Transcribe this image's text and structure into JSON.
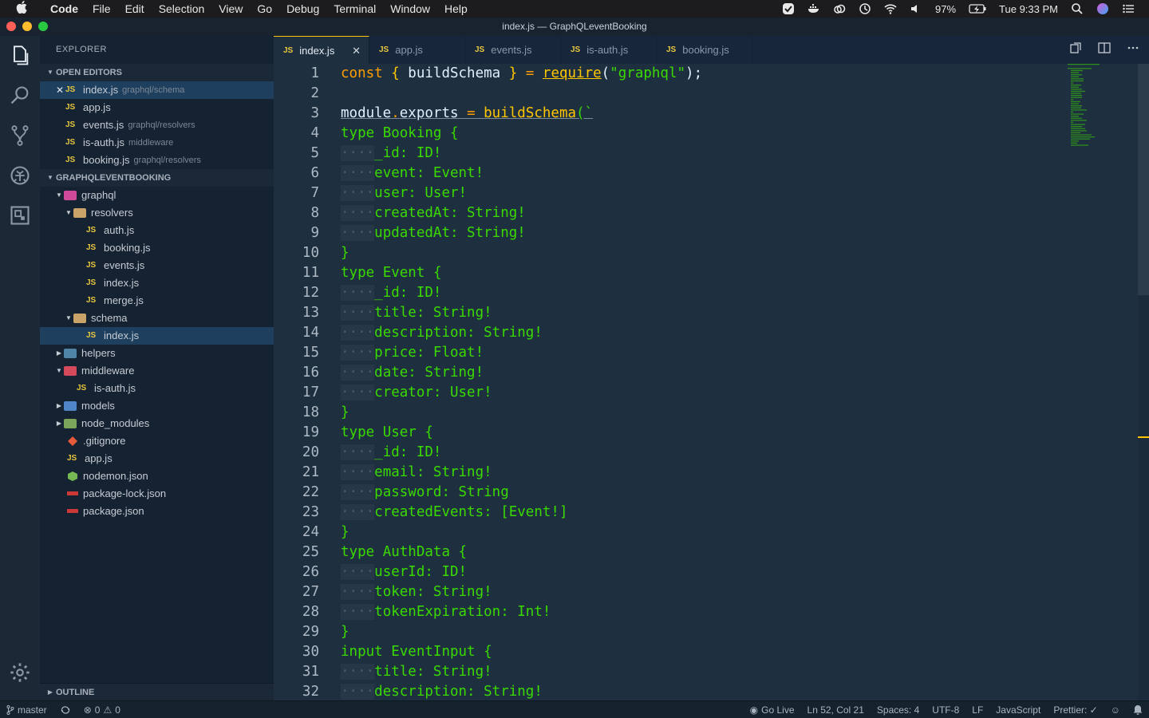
{
  "menubar": {
    "app": "Code",
    "items": [
      "File",
      "Edit",
      "Selection",
      "View",
      "Go",
      "Debug",
      "Terminal",
      "Window",
      "Help"
    ],
    "battery": "97%",
    "clock": "Tue 9:33 PM"
  },
  "window": {
    "title": "index.js — GraphQLeventBooking"
  },
  "sidebar": {
    "title": "EXPLORER",
    "open_editors_label": "OPEN EDITORS",
    "open_editors": [
      {
        "name": "index.js",
        "desc": "graphql/schema"
      },
      {
        "name": "app.js",
        "desc": ""
      },
      {
        "name": "events.js",
        "desc": "graphql/resolvers"
      },
      {
        "name": "is-auth.js",
        "desc": "middleware"
      },
      {
        "name": "booking.js",
        "desc": "graphql/resolvers"
      }
    ],
    "project_label": "GRAPHQLEVENTBOOKING",
    "tree": {
      "graphql": "graphql",
      "resolvers": "resolvers",
      "auth": "auth.js",
      "booking": "booking.js",
      "events": "events.js",
      "resolvers_index": "index.js",
      "merge": "merge.js",
      "schema": "schema",
      "schema_index": "index.js",
      "helpers": "helpers",
      "middleware": "middleware",
      "is_auth": "is-auth.js",
      "models": "models",
      "node_modules": "node_modules",
      "gitignore": ".gitignore",
      "app": "app.js",
      "nodemon": "nodemon.json",
      "package_lock": "package-lock.json",
      "package": "package.json"
    },
    "outline_label": "OUTLINE"
  },
  "tabs": [
    {
      "label": "index.js"
    },
    {
      "label": "app.js"
    },
    {
      "label": "events.js"
    },
    {
      "label": "is-auth.js"
    },
    {
      "label": "booking.js"
    }
  ],
  "code": {
    "line1": {
      "kw": "const",
      "p1": " { ",
      "id": "buildSchema",
      "p2": " } ",
      "eq": "=",
      "sp": " ",
      "req": "require",
      "open": "(",
      "str": "\"graphql\"",
      "close": ");"
    },
    "line3": {
      "obj": "module",
      "dot": ".",
      "prop": "exports",
      "eq": " = ",
      "fn": "buildSchema",
      "open": "(`"
    },
    "types": [
      {
        "line": 4,
        "kw": "type",
        "name": "Booking"
      },
      {
        "line": 11,
        "kw": "type",
        "name": "Event"
      },
      {
        "line": 19,
        "kw": "type",
        "name": "User"
      },
      {
        "line": 25,
        "kw": "type",
        "name": "AuthData"
      },
      {
        "line": 30,
        "kw": "input",
        "name": "EventInput"
      }
    ],
    "fields": {
      "5": "_id: ID!",
      "6": "event: Event!",
      "7": "user: User!",
      "8": "createdAt: String!",
      "9": "updatedAt: String!",
      "12": "_id: ID!",
      "13": "title: String!",
      "14": "description: String!",
      "15": "price: Float!",
      "16": "date: String!",
      "17": "creator: User!",
      "20": "_id: ID!",
      "21": "email: String!",
      "22": "password: String",
      "23": "createdEvents: [Event!]",
      "26": "userId: ID!",
      "27": "token: String!",
      "28": "tokenExpiration: Int!",
      "31": "title: String!",
      "32": "description: String!"
    },
    "brace_open": "{",
    "brace_close": "}",
    "indent_dots": "····"
  },
  "statusbar": {
    "branch": "master",
    "errors": "0",
    "warnings": "0",
    "golive": "Go Live",
    "position": "Ln 52, Col 21",
    "spaces": "Spaces: 4",
    "encoding": "UTF-8",
    "eol": "LF",
    "language": "JavaScript",
    "prettier": "Prettier: ✓"
  },
  "colors": {
    "accent": "#ffc600",
    "keyword": "#ff9d00",
    "string": "#3ad900"
  }
}
